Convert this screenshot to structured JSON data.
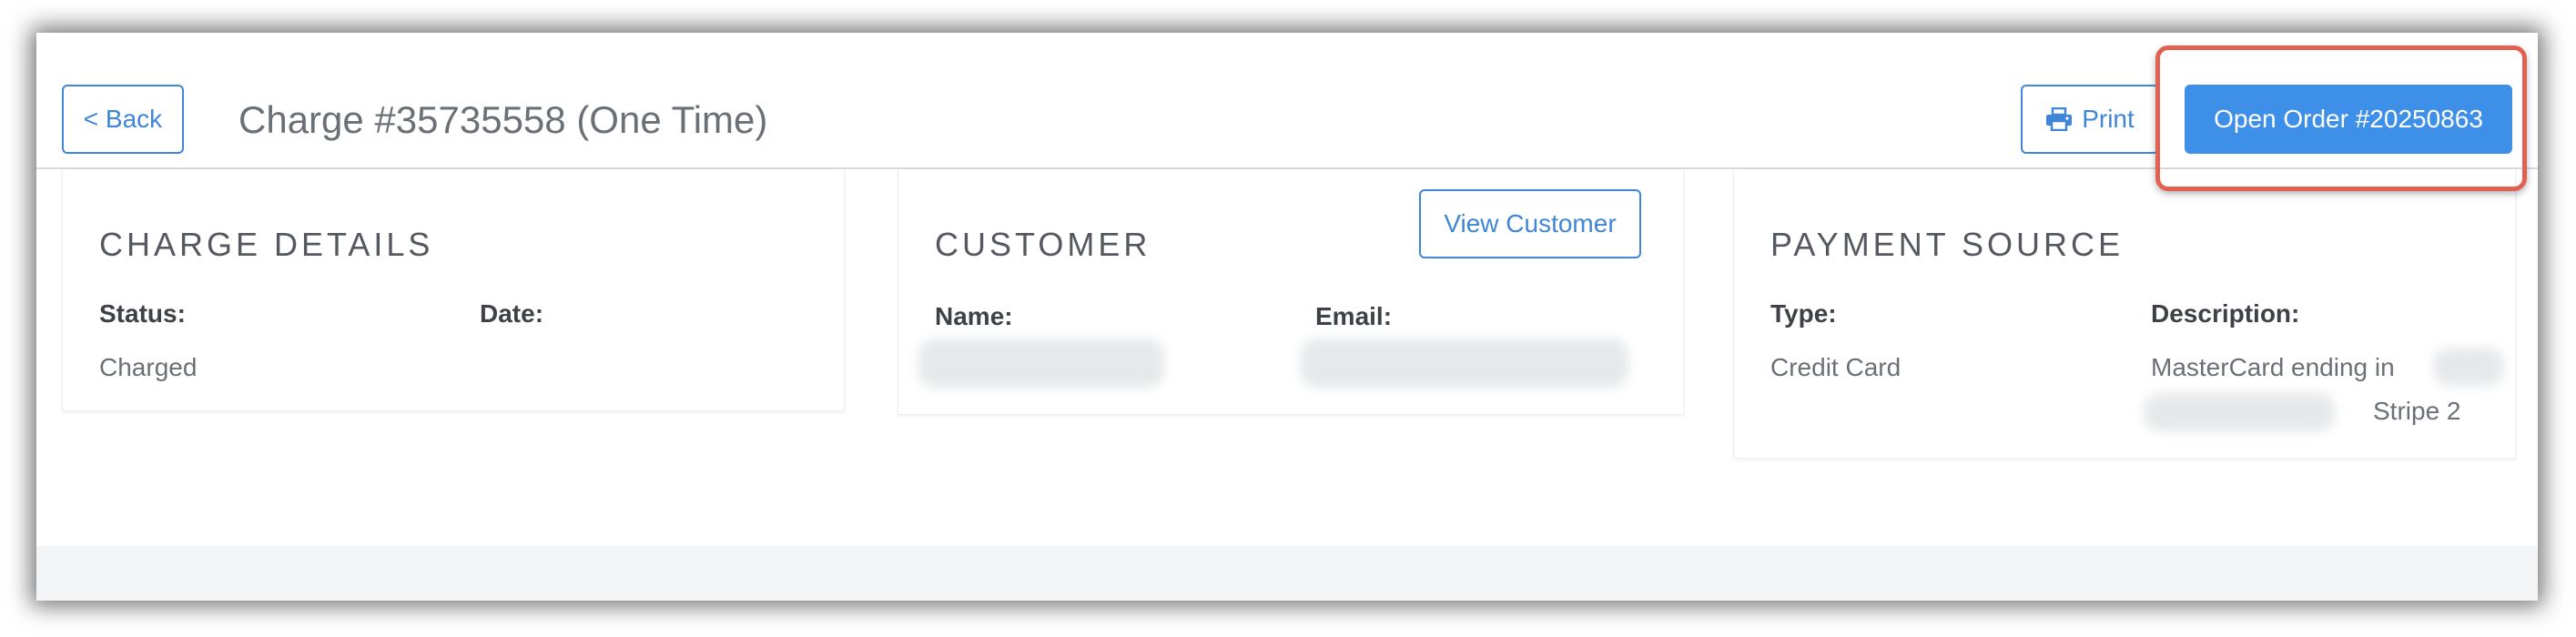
{
  "header": {
    "back_label": "< Back",
    "title": "Charge #35735558 (One Time)",
    "print_label": "Print",
    "open_order_label": "Open Order #20250863"
  },
  "charge_details": {
    "title": "CHARGE DETAILS",
    "status_label": "Status:",
    "status_value": "Charged",
    "date_label": "Date:",
    "date_value": ""
  },
  "customer": {
    "title": "CUSTOMER",
    "view_customer_label": "View Customer",
    "name_label": "Name:",
    "email_label": "Email:"
  },
  "payment_source": {
    "title": "PAYMENT SOURCE",
    "type_label": "Type:",
    "type_value": "Credit Card",
    "description_label": "Description:",
    "description_line1": "MasterCard ending in",
    "description_line2": "Stripe 2"
  },
  "colors": {
    "accent": "#3d8fe8",
    "highlight": "#e06052",
    "text": "#3e4247",
    "muted": "#6b7077"
  },
  "icons": {
    "print": "printer-icon"
  }
}
